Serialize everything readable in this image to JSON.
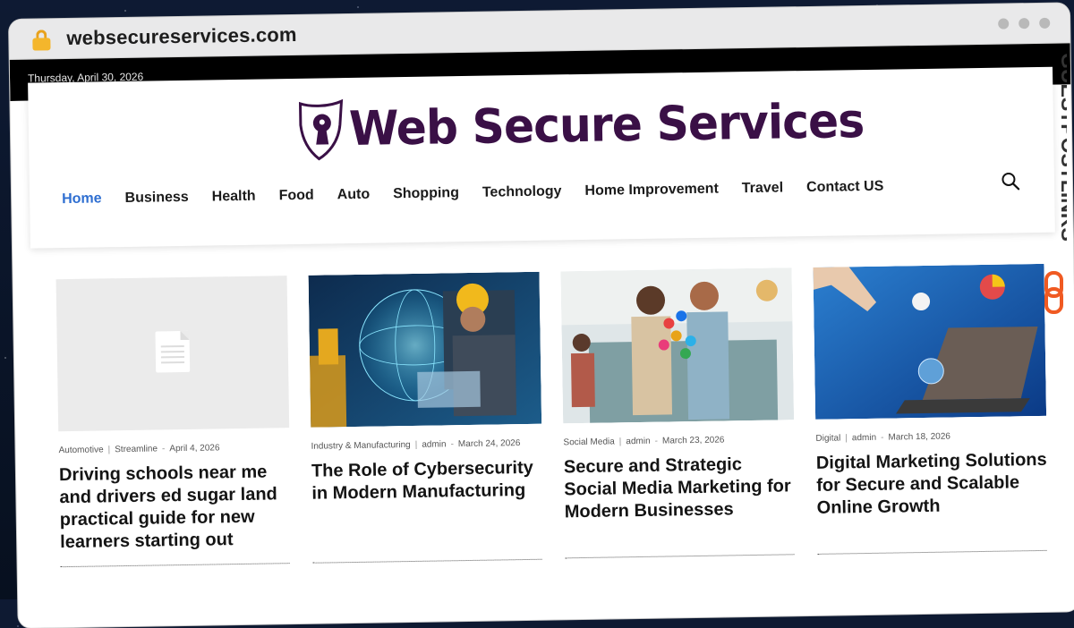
{
  "browser": {
    "url": "websecureservices.com"
  },
  "site": {
    "date": "Thursday, April 30, 2026",
    "logo_text": "Web Secure Services",
    "nav": [
      "Home",
      "Business",
      "Health",
      "Food",
      "Auto",
      "Shopping",
      "Technology",
      "Home Improvement",
      "Travel",
      "Contact US"
    ],
    "active_nav": "Home"
  },
  "posts": [
    {
      "category": "Automotive",
      "author": "Streamline",
      "date": "April 4, 2026",
      "title": "Driving schools near me and drivers ed sugar land practical guide for new learners starting out",
      "image": "placeholder"
    },
    {
      "category": "Industry & Manufacturing",
      "author": "admin",
      "date": "March 24, 2026",
      "title": "The Role of Cybersecurity in Modern Manufacturing",
      "image": "cyber-globe-engineer"
    },
    {
      "category": "Social Media",
      "author": "admin",
      "date": "March 23, 2026",
      "title": "Secure and Strategic Social Media Marketing for Modern Businesses",
      "image": "people-social-icons"
    },
    {
      "category": "Digital",
      "author": "admin",
      "date": "March 18, 2026",
      "title": "Digital Marketing Solutions for Secure and Scalable Online Growth",
      "image": "laptop-charts"
    }
  ],
  "badge": {
    "text": "GUESTPOSTLINKS"
  },
  "colors": {
    "accent": "#2f6fd1",
    "logo": "#3a1046",
    "badge": "#f05a22"
  }
}
